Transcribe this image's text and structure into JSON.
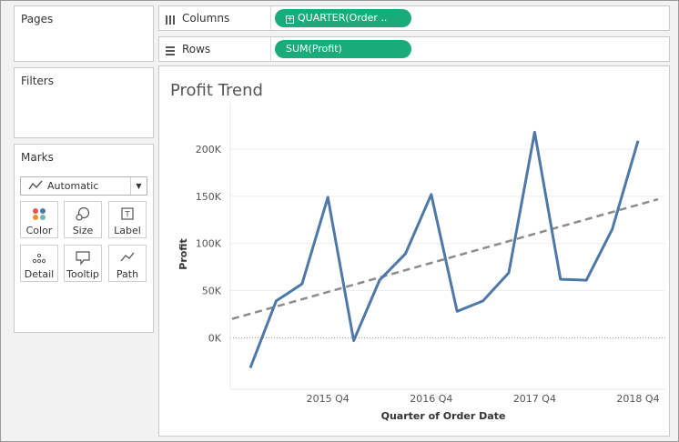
{
  "cards": {
    "pages_title": "Pages",
    "filters_title": "Filters",
    "marks_title": "Marks"
  },
  "shelves": {
    "columns_label": "Columns",
    "columns_pill": "QUARTER(Order ..",
    "rows_label": "Rows",
    "rows_pill": "SUM(Profit)"
  },
  "marks": {
    "type_selected": "Automatic",
    "buttons": [
      {
        "label": "Color",
        "icon": "color-icon"
      },
      {
        "label": "Size",
        "icon": "size-icon"
      },
      {
        "label": "Label",
        "icon": "label-icon"
      },
      {
        "label": "Detail",
        "icon": "detail-icon"
      },
      {
        "label": "Tooltip",
        "icon": "tooltip-icon"
      },
      {
        "label": "Path",
        "icon": "path-icon"
      }
    ]
  },
  "colors": {
    "pill_green": "#19ac7a",
    "line_blue": "#4e79a7",
    "trend_gray": "#8c8c8c"
  },
  "chart_data": {
    "type": "line",
    "title": "Profit Trend",
    "xlabel": "Quarter of Order Date",
    "ylabel": "Profit",
    "x_ticks": [
      "2015 Q4",
      "2016 Q4",
      "2017 Q4",
      "2018 Q4"
    ],
    "y_ticks": [
      "0K",
      "50K",
      "100K",
      "150K",
      "200K"
    ],
    "ylim": [
      -45000,
      230000
    ],
    "x_range": [
      "2015 Q1",
      "2018 Q4"
    ],
    "categories": [
      "2015 Q1",
      "2015 Q2",
      "2015 Q3",
      "2015 Q4",
      "2016 Q1",
      "2016 Q2",
      "2016 Q3",
      "2016 Q4",
      "2017 Q1",
      "2017 Q2",
      "2017 Q3",
      "2017 Q4",
      "2018 Q1",
      "2018 Q2",
      "2018 Q3",
      "2018 Q4"
    ],
    "series": [
      {
        "values": [
          -32000,
          39000,
          57000,
          149000,
          -3000,
          61000,
          89000,
          152000,
          28000,
          39000,
          69000,
          218000,
          62000,
          61000,
          115000,
          209000
        ]
      }
    ],
    "trend_line": {
      "style": "dashed",
      "start": 20000,
      "end": 147000
    },
    "grid": "horizontal",
    "zero_line": "dotted"
  }
}
